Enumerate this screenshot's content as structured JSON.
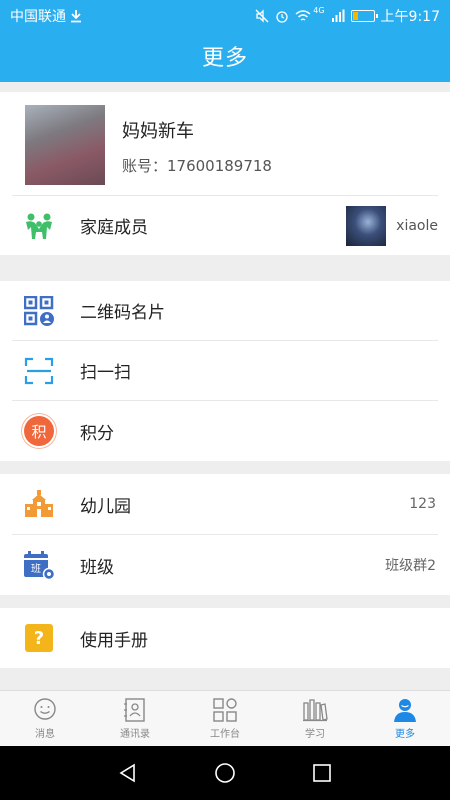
{
  "status_bar": {
    "carrier": "中国联通",
    "time": "上午9:17",
    "network": "4G"
  },
  "header": {
    "title": "更多"
  },
  "profile": {
    "name": "妈妈新车",
    "account": "账号：17600189718"
  },
  "family": {
    "label": "家庭成员",
    "member_name": "xiaole"
  },
  "menu_group_1": [
    {
      "label": "二维码名片",
      "icon": "qr-card-icon"
    },
    {
      "label": "扫一扫",
      "icon": "scan-icon"
    },
    {
      "label": "积分",
      "icon": "points-icon",
      "icon_text": "积"
    }
  ],
  "menu_group_2": [
    {
      "label": "幼儿园",
      "value": "123",
      "icon": "school-icon"
    },
    {
      "label": "班级",
      "value": "班级群2",
      "icon": "class-calendar-icon",
      "icon_text": "班"
    }
  ],
  "menu_group_3": [
    {
      "label": "使用手册",
      "icon": "help-icon",
      "icon_text": "?"
    }
  ],
  "tabs": [
    {
      "label": "消息",
      "icon": "message-icon"
    },
    {
      "label": "通讯录",
      "icon": "contacts-icon"
    },
    {
      "label": "工作台",
      "icon": "workbench-icon"
    },
    {
      "label": "学习",
      "icon": "study-icon"
    },
    {
      "label": "更多",
      "icon": "more-icon",
      "active": true
    }
  ],
  "colors": {
    "primary": "#29aef0",
    "active_tab": "#1e88e5",
    "points": "#f0673c",
    "school": "#f29a35",
    "help": "#f3b51a",
    "family": "#3fbf6a",
    "qr": "#3f6fc5"
  }
}
